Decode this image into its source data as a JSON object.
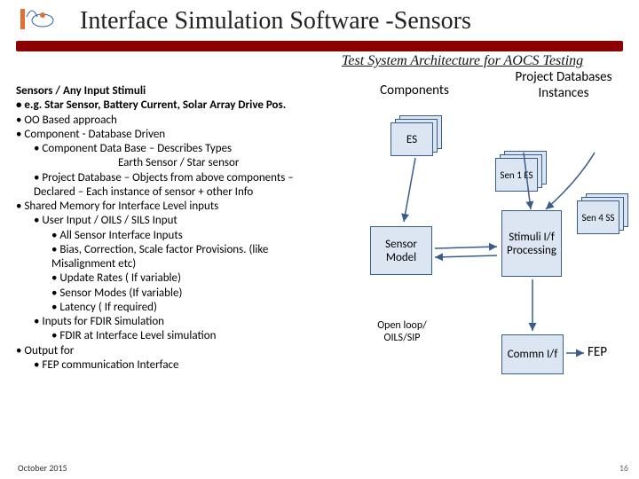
{
  "title": "Interface Simulation Software -Sensors",
  "banner": "Test System Architecture for AOCS Testing",
  "col1": "Components",
  "col2": "Project Databases Instances",
  "stackES": "ES",
  "sen1": "Sen 1 ES",
  "sen4": "Sen 4 SS",
  "sensorModel": "Sensor Model",
  "stimuli": "Stimuli I/f Processing",
  "openloop": "Open loop/ OILS/SIP",
  "commn": "Commn I/f",
  "fep": "FEP",
  "date": "October 2015",
  "page": "16",
  "text": {
    "h1": "Sensors / Any Input Stimuli",
    "l1": "• e.g. Star Sensor, Battery Current,  Solar Array Drive Pos.",
    "l2": "• OO Based approach",
    "l3": "• Component - Database Driven",
    "l4": "• Component Data Base – Describes Types",
    "l5": "Earth Sensor / Star sensor",
    "l6": "• Project Database – Objects from above components –",
    "l7": "Declared – Each instance of sensor + other Info",
    "l8": "• Shared Memory for Interface Level inputs",
    "l9": "• User Input / OILS / SILS Input",
    "l10": "• All Sensor Interface Inputs",
    "l11": "• Bias, Correction, Scale factor Provisions. (like",
    "l12": "Misalignment etc)",
    "l13": "• Update Rates ( If variable)",
    "l14": "• Sensor Modes (If variable)",
    "l15": "• Latency ( If required)",
    "l16": "• Inputs for FDIR Simulation",
    "l17": "• FDIR at Interface Level simulation",
    "l18": "• Output for",
    "l19": "• FEP communication Interface"
  }
}
